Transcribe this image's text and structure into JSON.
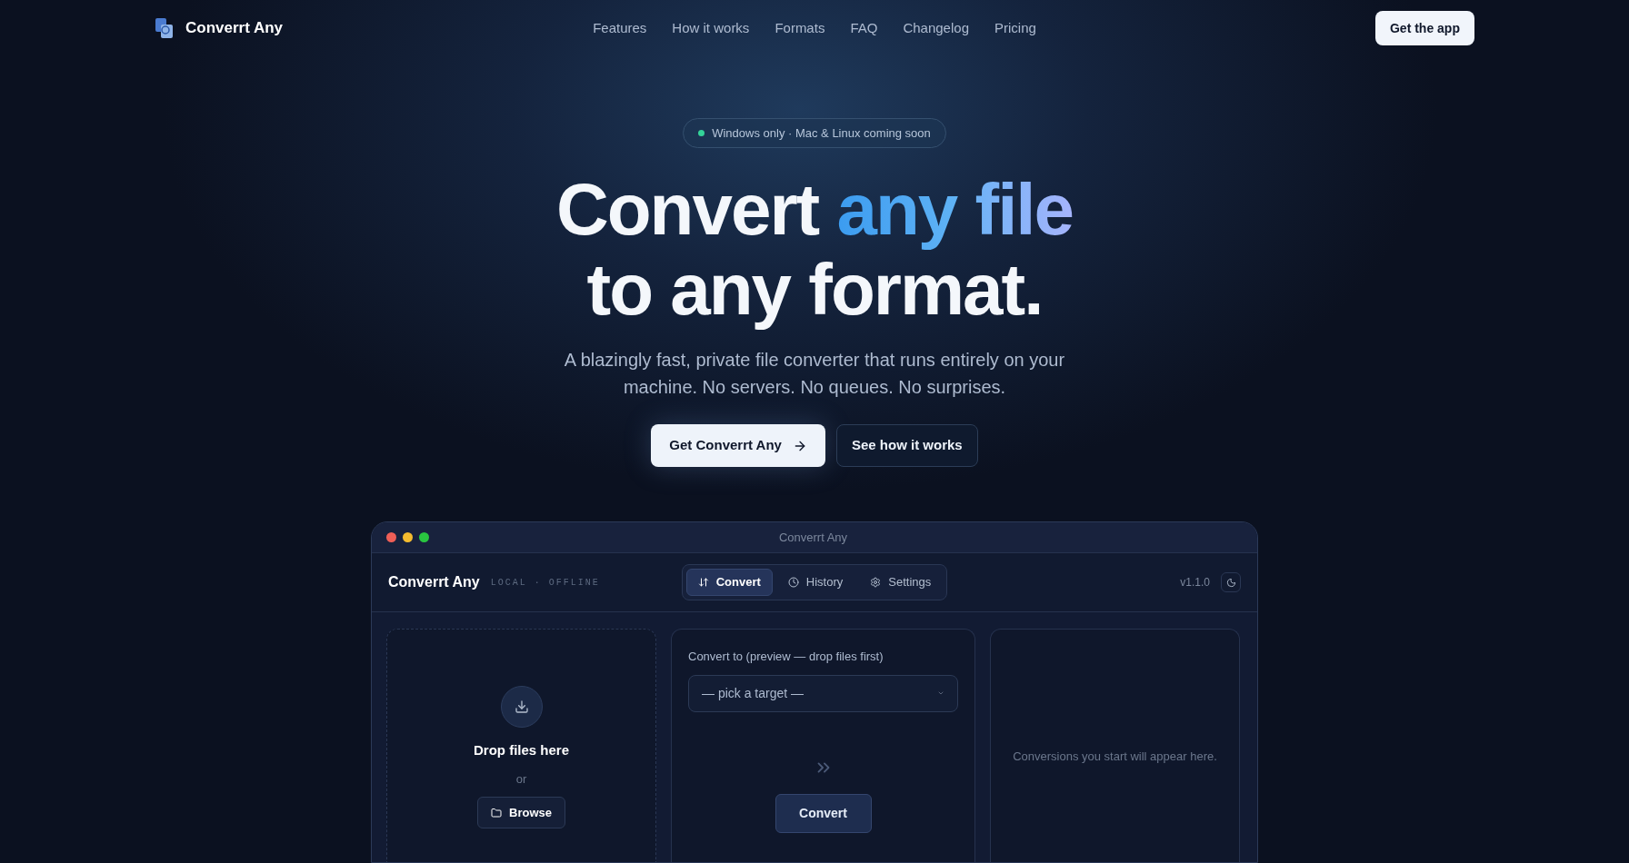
{
  "nav": {
    "brand": "Converrt Any",
    "links": [
      "Features",
      "How it works",
      "Formats",
      "FAQ",
      "Changelog",
      "Pricing"
    ],
    "cta": "Get the app"
  },
  "hero": {
    "badge": "Windows only · Mac & Linux coming soon",
    "headline_start": "Convert",
    "headline_highlight": "any file",
    "headline_end": "to any format.",
    "subtitle": "A blazingly fast, private file converter that runs entirely on your machine. No servers. No queues. No surprises.",
    "primary_button": "Get Converrt Any",
    "secondary_button": "See how it works"
  },
  "app_window": {
    "title": "Converrt Any",
    "brand": "Converrt Any",
    "tagline": "LOCAL · OFFLINE",
    "tabs": [
      {
        "label": "Convert",
        "selected": true
      },
      {
        "label": "History",
        "selected": false
      },
      {
        "label": "Settings",
        "selected": false
      }
    ],
    "version": "v1.1.0",
    "drop_panel": {
      "title": "Drop files here",
      "or": "or",
      "browse": "Browse"
    },
    "convert_panel": {
      "label": "Convert to (preview — drop files first)",
      "select_placeholder": "— pick a target —",
      "button": "Convert"
    },
    "queue_panel": {
      "empty": "Conversions you start will appear here."
    }
  }
}
